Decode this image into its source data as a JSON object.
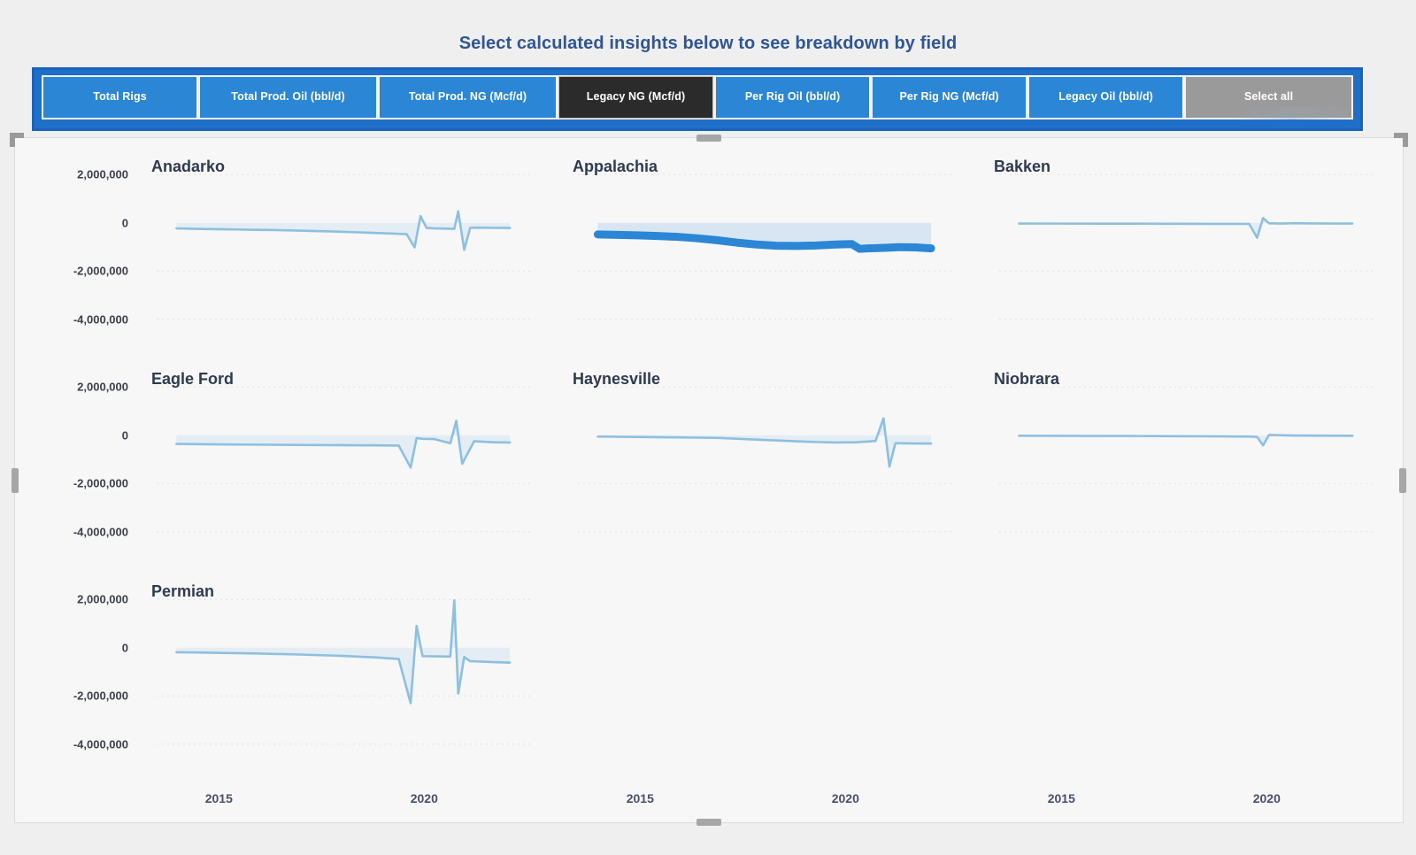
{
  "header": {
    "title": "Select calculated insights below to see breakdown by field"
  },
  "slicer": {
    "buttons": [
      {
        "label": "Select all",
        "state": "select-all"
      },
      {
        "label": "Legacy Oil (bbl/d)",
        "state": "unselected"
      },
      {
        "label": "Per Rig NG (Mcf/d)",
        "state": "unselected"
      },
      {
        "label": "Per Rig Oil (bbl/d)",
        "state": "unselected"
      },
      {
        "label": "Legacy NG (Mcf/d)",
        "state": "selected"
      },
      {
        "label": "Total Prod. NG (Mcf/d)",
        "state": "unselected"
      },
      {
        "label": "Total Prod. Oil (bbl/d)",
        "state": "unselected"
      },
      {
        "label": "Total Rigs",
        "state": "unselected"
      }
    ],
    "selected_label": "Legacy NG (Mcf/d)",
    "colors": {
      "unselected_bg": "#2b87d6",
      "selected_bg": "#2b2b2b",
      "select_all_bg": "#9a9a9a",
      "frame_bg": "#1f6ec7",
      "title_color": "#2f5597"
    }
  },
  "chart_data": {
    "type": "line",
    "title": "Select calculated insights below to see breakdown by field",
    "xlabel": "",
    "ylabel": "",
    "ylim": [
      -5000000,
      3000000
    ],
    "yticks": [
      2000000,
      0,
      -2000000,
      -4000000
    ],
    "ytick_labels": [
      "2,000,000",
      "0",
      "-2,000,000",
      "-4,000,000"
    ],
    "xlim": [
      2013.5,
      2023.0
    ],
    "xticks": [
      2015,
      2020
    ],
    "xtick_labels": [
      "2015",
      "2020"
    ],
    "grid": true,
    "legend": false,
    "series_colors": {
      "unselected": "#8dc0e0",
      "selected": "#2b87d6",
      "band": "#d6e4f2"
    },
    "panels": [
      {
        "name": "Anadarko",
        "highlighted": false,
        "x": [
          2014.0,
          2014.5,
          2015.0,
          2015.5,
          2016.0,
          2016.5,
          2017.0,
          2017.5,
          2018.0,
          2018.5,
          2019.0,
          2019.5,
          2019.8,
          2020.0,
          2020.15,
          2020.3,
          2020.5,
          2020.8,
          2021.0,
          2021.1,
          2021.25,
          2021.4,
          2021.6,
          2022.0,
          2022.4
        ],
        "y": [
          -230000,
          -250000,
          -265000,
          -275000,
          -290000,
          -300000,
          -320000,
          -340000,
          -360000,
          -390000,
          -420000,
          -450000,
          -470000,
          -1020000,
          280000,
          -210000,
          -230000,
          -240000,
          -250000,
          480000,
          -1120000,
          -210000,
          -200000,
          -210000,
          -215000
        ]
      },
      {
        "name": "Appalachia",
        "highlighted": true,
        "x": [
          2014.0,
          2014.5,
          2015.0,
          2015.5,
          2016.0,
          2016.5,
          2017.0,
          2017.5,
          2018.0,
          2018.5,
          2019.0,
          2019.5,
          2020.0,
          2020.4,
          2020.6,
          2020.8,
          2021.0,
          2021.3,
          2021.6,
          2022.0,
          2022.4
        ],
        "y": [
          -480000,
          -500000,
          -520000,
          -545000,
          -580000,
          -640000,
          -720000,
          -820000,
          -900000,
          -950000,
          -960000,
          -940000,
          -900000,
          -880000,
          -1080000,
          -1060000,
          -1050000,
          -1030000,
          -1010000,
          -1020000,
          -1060000
        ],
        "band_top": 0
      },
      {
        "name": "Bakken",
        "highlighted": false,
        "x": [
          2014.0,
          2015.0,
          2016.0,
          2017.0,
          2018.0,
          2019.0,
          2019.8,
          2020.0,
          2020.15,
          2020.3,
          2020.6,
          2021.0,
          2021.4,
          2022.0,
          2022.4
        ],
        "y": [
          -30000,
          -32000,
          -34000,
          -36000,
          -38000,
          -42000,
          -46000,
          -620000,
          200000,
          -20000,
          -30000,
          -15000,
          -25000,
          -28000,
          -28000
        ]
      },
      {
        "name": "Eagle Ford",
        "highlighted": false,
        "x": [
          2014.0,
          2014.5,
          2015.0,
          2016.0,
          2017.0,
          2018.0,
          2019.0,
          2019.6,
          2019.9,
          2020.05,
          2020.2,
          2020.5,
          2020.9,
          2021.05,
          2021.2,
          2021.5,
          2022.0,
          2022.4
        ],
        "y": [
          -360000,
          -370000,
          -380000,
          -390000,
          -400000,
          -410000,
          -420000,
          -430000,
          -1340000,
          -120000,
          -150000,
          -160000,
          -330000,
          600000,
          -1180000,
          -250000,
          -290000,
          -300000
        ]
      },
      {
        "name": "Haynesville",
        "highlighted": false,
        "x": [
          2014.0,
          2015.0,
          2016.0,
          2017.0,
          2018.0,
          2019.0,
          2019.5,
          2020.0,
          2020.5,
          2021.0,
          2021.2,
          2021.35,
          2021.5,
          2022.0,
          2022.4
        ],
        "y": [
          -55000,
          -70000,
          -90000,
          -110000,
          -180000,
          -250000,
          -280000,
          -300000,
          -290000,
          -240000,
          700000,
          -1300000,
          -330000,
          -340000,
          -345000
        ],
        "band_top": 0
      },
      {
        "name": "Niobrara",
        "highlighted": false,
        "x": [
          2014.0,
          2015.0,
          2016.0,
          2017.0,
          2018.0,
          2019.0,
          2019.8,
          2020.0,
          2020.15,
          2020.3,
          2020.6,
          2021.0,
          2021.5,
          2022.0,
          2022.4
        ],
        "y": [
          -22000,
          -24000,
          -28000,
          -32000,
          -38000,
          -46000,
          -55000,
          -70000,
          -420000,
          10000,
          0,
          -10000,
          -15000,
          -18000,
          -20000
        ]
      },
      {
        "name": "Permian",
        "highlighted": false,
        "x": [
          2014.0,
          2014.5,
          2015.0,
          2016.0,
          2017.0,
          2018.0,
          2019.0,
          2019.6,
          2019.9,
          2020.05,
          2020.2,
          2020.5,
          2020.9,
          2021.0,
          2021.1,
          2021.25,
          2021.4,
          2022.0,
          2022.4
        ],
        "y": [
          -190000,
          -200000,
          -215000,
          -240000,
          -280000,
          -330000,
          -400000,
          -470000,
          -2300000,
          900000,
          -350000,
          -360000,
          -370000,
          1960000,
          -1900000,
          -390000,
          -560000,
          -600000,
          -620000
        ]
      }
    ]
  },
  "axes": {
    "y_labels": [
      "2,000,000",
      "0",
      "-2,000,000",
      "-4,000,000"
    ],
    "x_labels": [
      "2015",
      "2020"
    ]
  },
  "panels_layout": {
    "row1": [
      "Anadarko",
      "Appalachia",
      "Bakken"
    ],
    "row2": [
      "Eagle Ford",
      "Haynesville",
      "Niobrara"
    ],
    "row3": [
      "Permian"
    ]
  }
}
